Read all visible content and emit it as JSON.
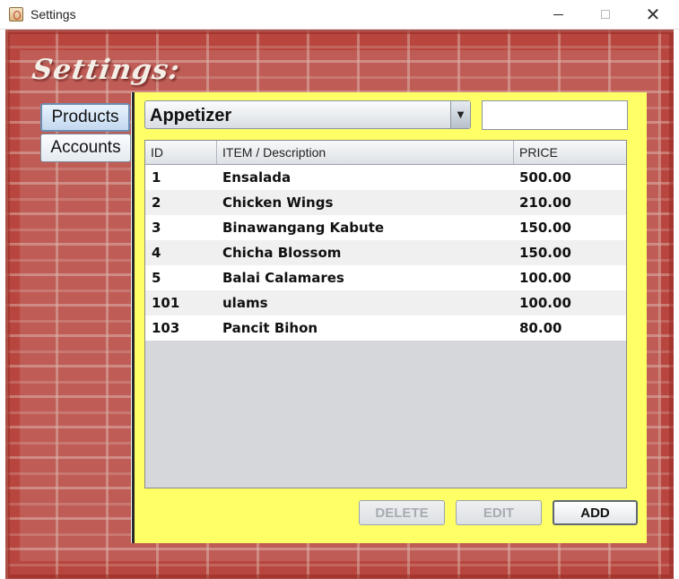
{
  "window": {
    "title": "Settings",
    "minimize_icon": "minimize-icon",
    "maximize_icon": "maximize-icon",
    "close_icon": "close-icon",
    "close_glyph": "✕"
  },
  "heading": "Settings:",
  "nav": {
    "products": "Products",
    "accounts": "Accounts"
  },
  "category": {
    "selected": "Appetizer",
    "arrow": "▼"
  },
  "search": {
    "value": "",
    "placeholder": ""
  },
  "table": {
    "columns": [
      "ID",
      "ITEM / Description",
      "PRICE"
    ],
    "rows": [
      {
        "id": "1",
        "item": "Ensalada",
        "price": "500.00"
      },
      {
        "id": "2",
        "item": "Chicken Wings",
        "price": "210.00"
      },
      {
        "id": "3",
        "item": "Binawangang Kabute",
        "price": "150.00"
      },
      {
        "id": "4",
        "item": "Chicha Blossom",
        "price": "150.00"
      },
      {
        "id": "5",
        "item": "Balai Calamares",
        "price": "100.00"
      },
      {
        "id": "101",
        "item": "ulams",
        "price": "100.00"
      },
      {
        "id": "103",
        "item": "Pancit Bihon",
        "price": "80.00"
      }
    ]
  },
  "actions": {
    "delete": "DELETE",
    "edit": "EDIT",
    "add": "ADD"
  },
  "colors": {
    "panel": "#ffff66",
    "brick": "#b8463f"
  }
}
